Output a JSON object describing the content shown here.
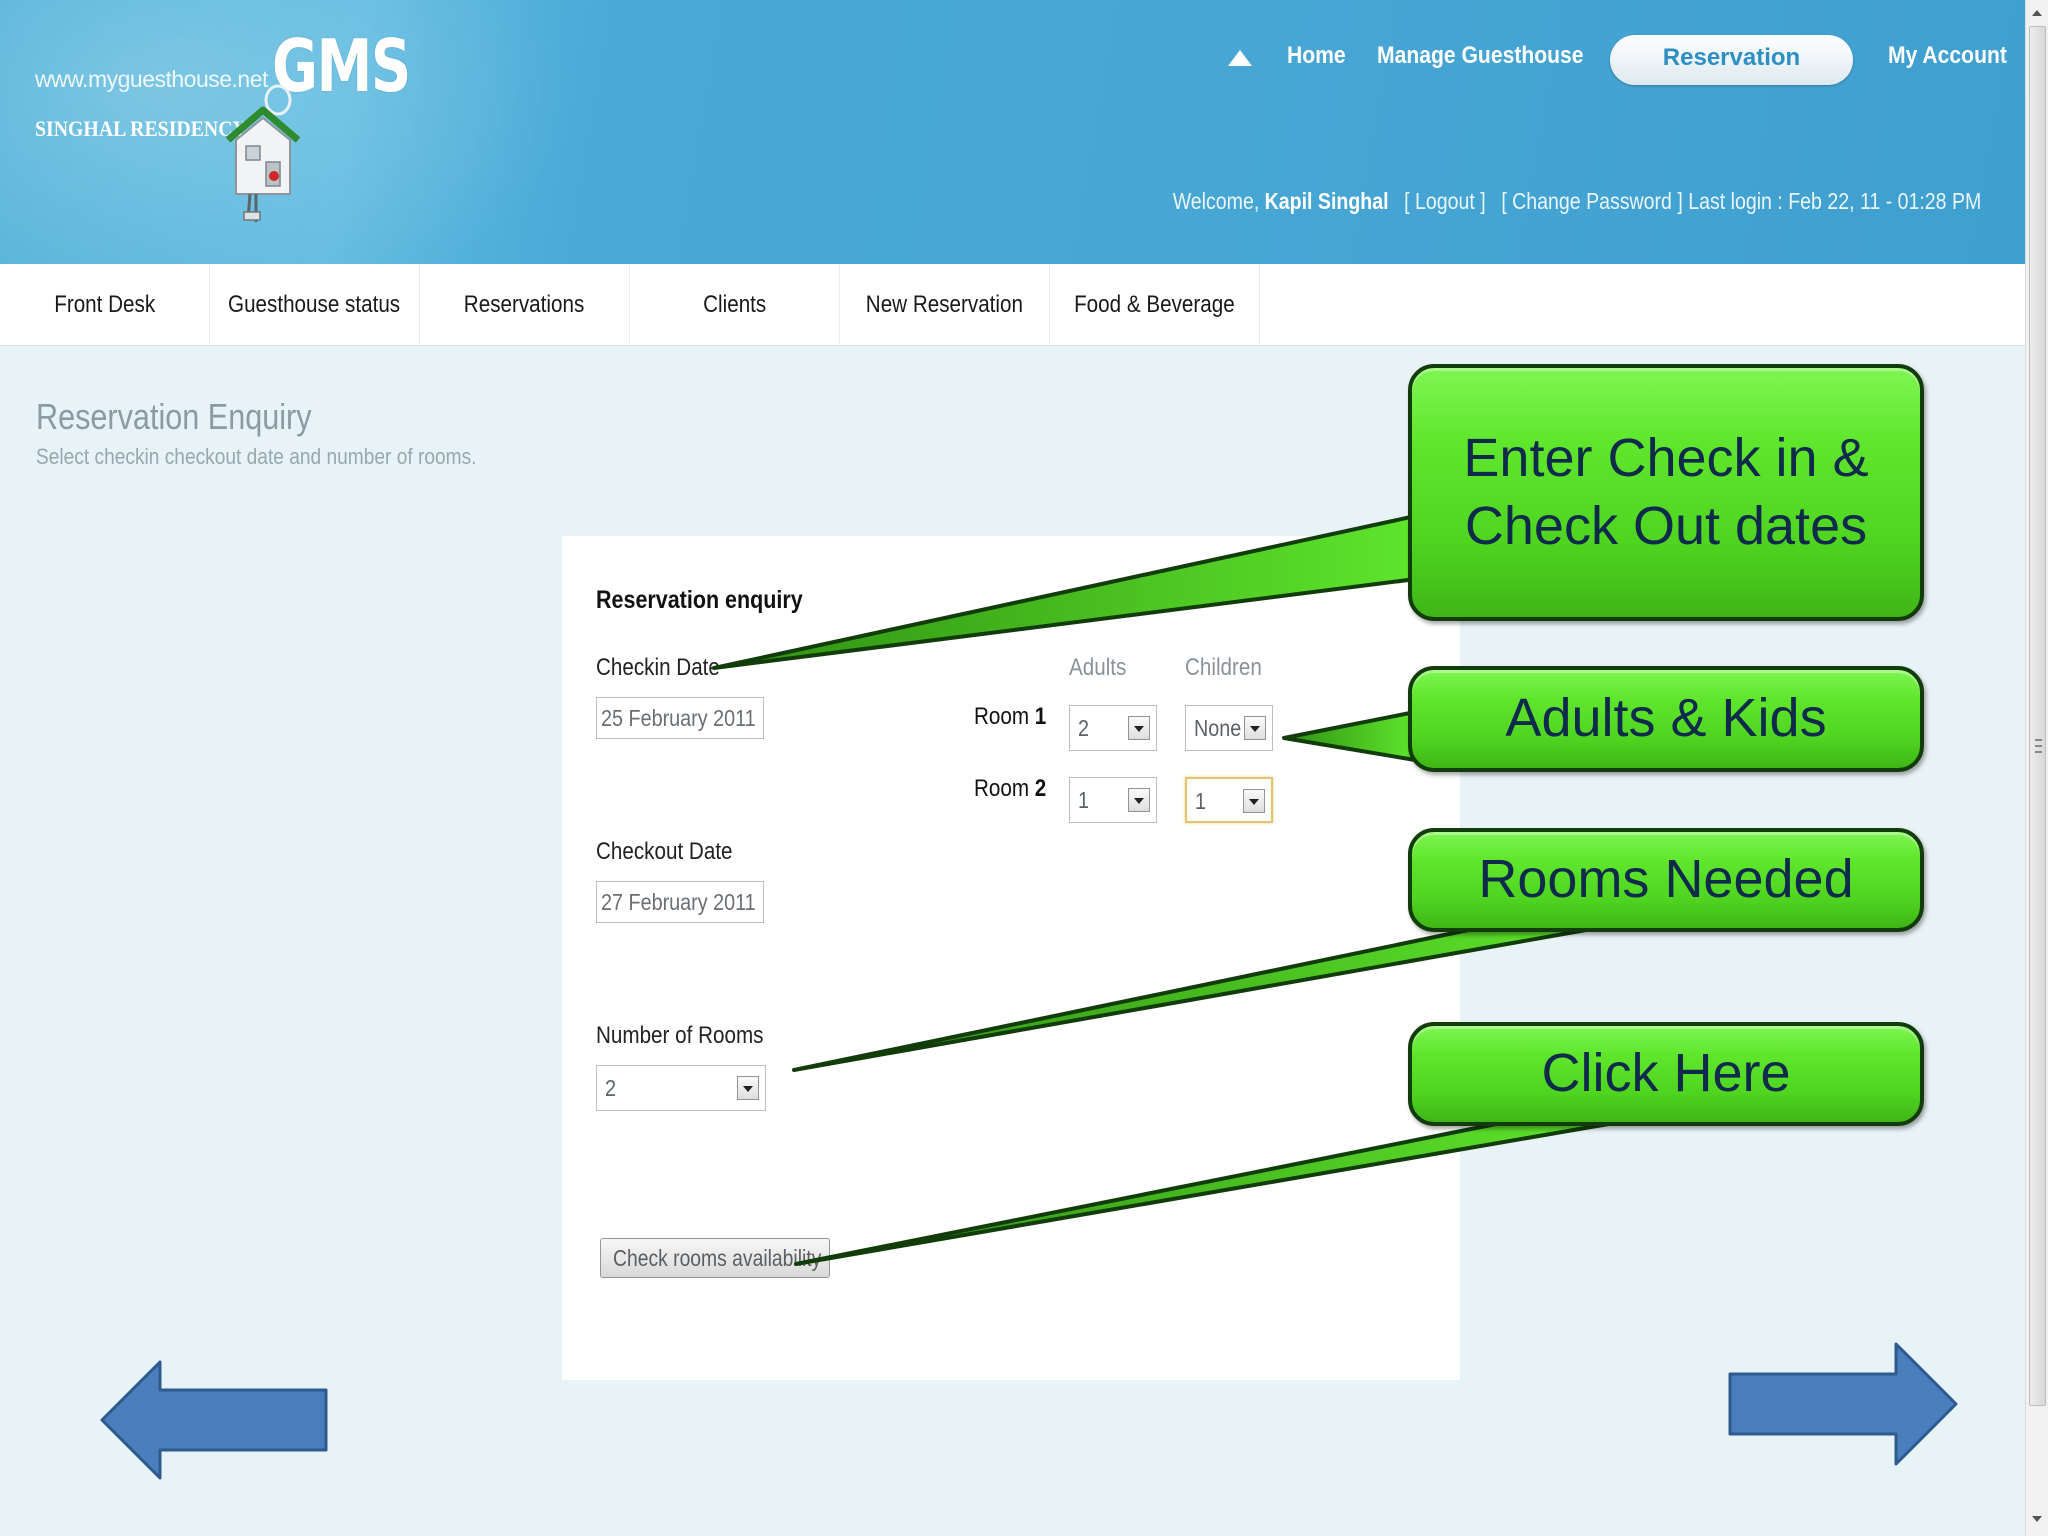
{
  "header": {
    "site_url": "www.myguesthouse.net",
    "logo_text": "GMS",
    "property_name": "SINGHAL RESIDENCY",
    "nav": {
      "home": "Home",
      "manage": "Manage Guesthouse",
      "reservation": "Reservation",
      "my_account": "My Account"
    },
    "welcome_prefix": "Welcome,",
    "user_name": "Kapil Singhal",
    "logout": "[ Logout ]",
    "change_password": "[ Change Password ]",
    "last_login": "Last login : Feb 22, 11 - 01:28 PM"
  },
  "menu": {
    "items": [
      "Front Desk",
      "Guesthouse status",
      "Reservations",
      "Clients",
      "New Reservation",
      "Food & Beverage"
    ]
  },
  "page": {
    "title": "Reservation Enquiry",
    "subtitle": "Select checkin checkout date and number of rooms."
  },
  "form": {
    "heading": "Reservation enquiry",
    "checkin_label": "Checkin Date",
    "checkin_value": "25 February 2011",
    "checkout_label": "Checkout Date",
    "checkout_value": "27 February 2011",
    "rooms_label": "Number of Rooms",
    "rooms_value": "2",
    "adults_header": "Adults",
    "children_header": "Children",
    "rooms": [
      {
        "label_prefix": "Room",
        "label_num": "1",
        "adults": "2",
        "children": "None"
      },
      {
        "label_prefix": "Room",
        "label_num": "2",
        "adults": "1",
        "children": "1"
      }
    ],
    "check_button": "Check rooms availability"
  },
  "callouts": {
    "dates": "Enter Check in & Check Out dates",
    "adults_kids": "Adults & Kids",
    "rooms_needed": "Rooms Needed",
    "click_here": "Click Here"
  },
  "colors": {
    "header_blue": "#47a6d4",
    "callout_green": "#5fe62c",
    "callout_text": "#0f2a4a",
    "arrow_blue": "#4a7ebd"
  },
  "icons": {
    "house": "house-keychain-icon",
    "nav_up": "triangle-up-icon",
    "prev": "left-arrow-icon",
    "next": "right-arrow-icon"
  }
}
